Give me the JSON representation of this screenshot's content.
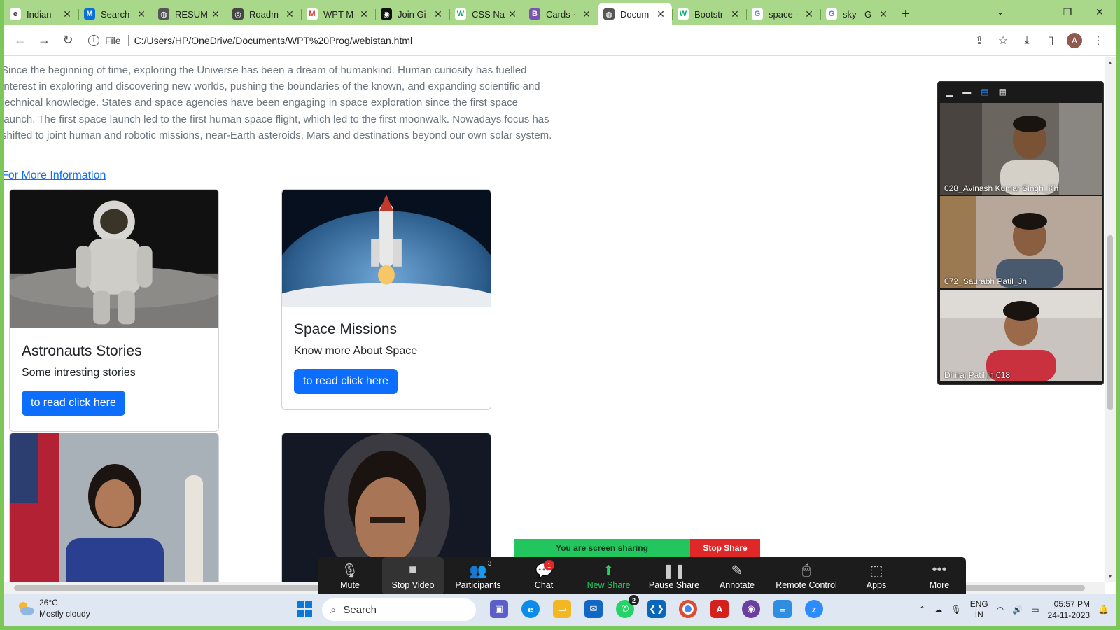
{
  "browser": {
    "tabs": [
      {
        "label": "Indian",
        "color": "#fff",
        "fg": "#333",
        "glyph": "e",
        "active": false
      },
      {
        "label": "Search",
        "color": "#0b6fd8",
        "fg": "#fff",
        "glyph": "M",
        "active": false
      },
      {
        "label": "RESUM",
        "color": "#555",
        "fg": "#fff",
        "glyph": "◍",
        "active": false
      },
      {
        "label": "Roadm",
        "color": "#444",
        "fg": "#fff",
        "glyph": "◎",
        "active": false
      },
      {
        "label": "WPT M",
        "color": "#fff",
        "fg": "#d93025",
        "glyph": "M",
        "active": false
      },
      {
        "label": "Join Gi",
        "color": "#111",
        "fg": "#fff",
        "glyph": "◉",
        "active": false
      },
      {
        "label": "CSS Na",
        "color": "#fff",
        "fg": "#04aa6d",
        "glyph": "W",
        "active": false
      },
      {
        "label": "Cards ·",
        "color": "#7952b3",
        "fg": "#fff",
        "glyph": "B",
        "active": false
      },
      {
        "label": "Docum",
        "color": "#555",
        "fg": "#fff",
        "glyph": "◍",
        "active": true
      },
      {
        "label": "Bootstr",
        "color": "#fff",
        "fg": "#04aa6d",
        "glyph": "W",
        "active": false
      },
      {
        "label": "space ·",
        "color": "#fff",
        "fg": "#4285f4",
        "glyph": "G",
        "active": false
      },
      {
        "label": "sky - G",
        "color": "#fff",
        "fg": "#4285f4",
        "glyph": "G",
        "active": false
      }
    ],
    "close_glyph": "✕",
    "new_tab_glyph": "+",
    "tab_search_glyph": "⌄",
    "window_controls": {
      "minimize": "—",
      "maximize": "❐",
      "close": "✕"
    },
    "nav": {
      "back": "←",
      "forward": "→",
      "reload": "↻"
    },
    "address": {
      "info": "i",
      "scheme": "File",
      "url": "C:/Users/HP/OneDrive/Documents/WPT%20Prog/webistan.html"
    },
    "right_tools": {
      "share": "⇪",
      "bookmark": "☆",
      "download": "⤓",
      "sidepanel": "▯",
      "avatar": "A",
      "menu": "⋮"
    }
  },
  "page": {
    "intro": "Since the beginning of time, exploring the Universe has been a dream of humankind. Human curiosity has fuelled interest in exploring and discovering new worlds, pushing the boundaries of the known, and expanding scientific and technical knowledge. States and space agencies have been engaging in space exploration since the first space launch. The first space launch led to the first human space flight, which led to the first moonwalk. Nowadays focus has shifted to joint human and robotic missions, near-Earth asteroids, Mars and destinations beyond our own solar system.",
    "more_link": "For More Information",
    "cards": [
      {
        "title": "Astronauts Stories",
        "text": "Some intresting stories",
        "button": "to read click here"
      },
      {
        "title": "Space Missions",
        "text": "Know more About Space",
        "button": "to read click here"
      }
    ]
  },
  "zoom": {
    "view_icons": [
      "▁",
      "▬",
      "▤",
      "▦"
    ],
    "participants": [
      {
        "name": "028_Avinash Kumar Singh_Kh"
      },
      {
        "name": "072_Saurabh Patil_Jh"
      },
      {
        "name": "Dhiraj Patil jh 018"
      }
    ],
    "sharing_text": "You are screen sharing",
    "stop_share": "Stop Share",
    "toolbar": [
      {
        "label": "Mute",
        "icon": "🎙",
        "state": "normal"
      },
      {
        "label": "Stop Video",
        "icon": "■",
        "state": "dark"
      },
      {
        "label": "Participants",
        "icon": "👥",
        "count": "3",
        "state": "normal"
      },
      {
        "label": "Chat",
        "icon": "💬",
        "badge": "1",
        "state": "normal"
      },
      {
        "label": "New Share",
        "icon": "⬆",
        "state": "green"
      },
      {
        "label": "Pause Share",
        "icon": "❚❚",
        "state": "normal"
      },
      {
        "label": "Annotate",
        "icon": "✎",
        "state": "normal"
      },
      {
        "label": "Remote Control",
        "icon": "🖱",
        "state": "normal"
      },
      {
        "label": "Apps",
        "icon": "⬚",
        "state": "normal"
      },
      {
        "label": "More",
        "icon": "•••",
        "state": "normal"
      }
    ]
  },
  "taskbar": {
    "weather": {
      "temp": "26°C",
      "condition": "Mostly cloudy"
    },
    "search_placeholder": "Search",
    "whatsapp_badge": "2",
    "tray": {
      "lang1": "ENG",
      "lang2": "IN",
      "time": "05:57 PM",
      "date": "24-11-2023"
    }
  }
}
